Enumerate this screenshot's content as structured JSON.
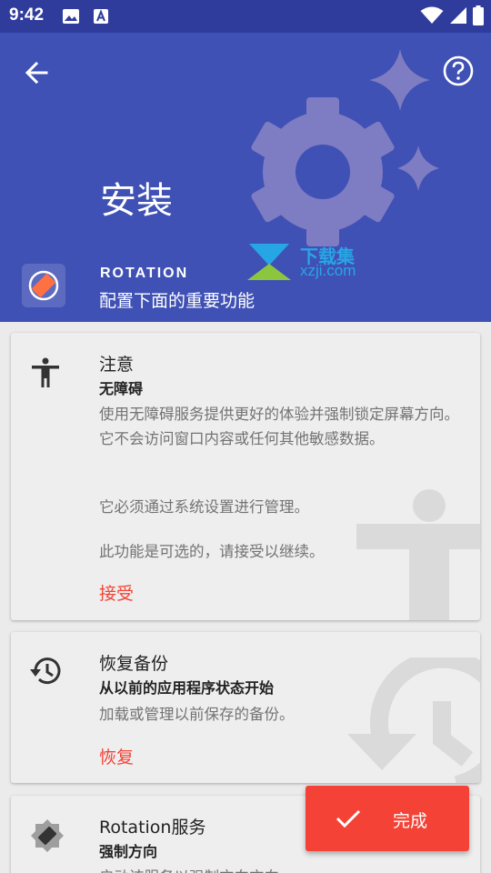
{
  "status_bar": {
    "time": "9:42"
  },
  "header": {
    "title": "安装",
    "app_name": "ROTATION",
    "subtitle": "配置下面的重要功能",
    "watermark_title": "下载集",
    "watermark_url": "xzji.com",
    "colors": {
      "primary": "#3f51b5",
      "status": "#2f3c9c"
    }
  },
  "cards": [
    {
      "icon": "accessibility-icon",
      "title": "注意",
      "subtitle": "无障碍",
      "body": [
        "使用无障碍服务提供更好的体验并强制锁定屏幕方向。它不会访问窗口内容或任何其他敏感数据。",
        "它必须通过系统设置进行管理。",
        "此功能是可选的，请接受以继续。"
      ],
      "action": "接受"
    },
    {
      "icon": "history-icon",
      "title": "恢复备份",
      "subtitle": "从以前的应用程序状态开始",
      "body": [
        "加载或管理以前保存的备份。"
      ],
      "action": "恢复"
    },
    {
      "icon": "rotation-service-icon",
      "title": "Rotation服务",
      "subtitle": "强制方向",
      "body": [
        "启动该服务以强制方向方向"
      ]
    }
  ],
  "fab": {
    "label": "完成",
    "color": "#f44336"
  }
}
